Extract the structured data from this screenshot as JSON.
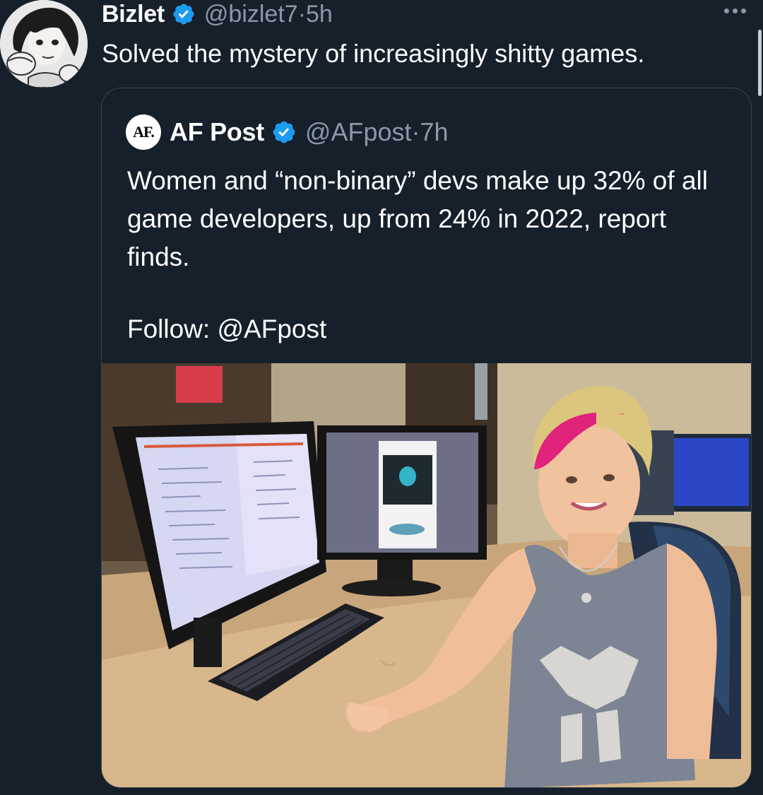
{
  "tweet": {
    "author_name": "Bizlet",
    "author_handle": "@bizlet7",
    "separator": " · ",
    "time": "5h",
    "text": "Solved the mystery of increasingly shitty games.",
    "avatar_icon": "manga-character-avatar",
    "verified_icon": "verified-badge-icon",
    "more_icon": "more-options-icon"
  },
  "quoted": {
    "logo_text": "AF.",
    "author_name": "AF Post",
    "author_handle": "@AFpost",
    "separator": " · ",
    "time": "7h",
    "text": "Women and “non-binary” devs make up 32% of all game developers, up from 24% in 2022, report finds.",
    "follow_text": "Follow: @AFpost",
    "verified_icon": "verified-badge-icon",
    "media_description_icon": "attached-photo"
  },
  "colors": {
    "background": "#15202b",
    "text": "#ffffff",
    "secondary_text": "#8b98a5",
    "verified": "#1d9bf0",
    "border": "#38444d"
  }
}
